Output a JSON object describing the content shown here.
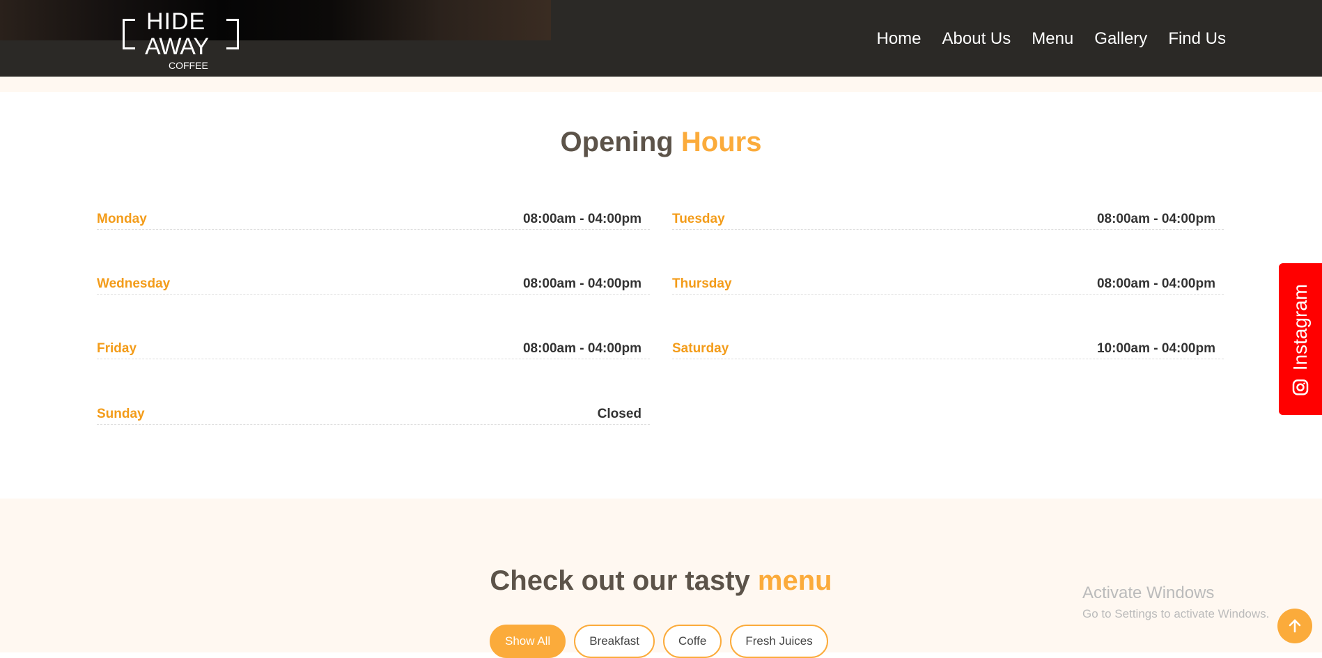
{
  "logo": {
    "line1": "HIDE",
    "line2": "AWAY",
    "line3": "COFFEE"
  },
  "nav": [
    "Home",
    "About Us",
    "Menu",
    "Gallery",
    "Find Us"
  ],
  "hours": {
    "title_a": "Opening",
    "title_b": "Hours",
    "rows": [
      {
        "day": "Monday",
        "hours": "08:00am - 04:00pm"
      },
      {
        "day": "Tuesday",
        "hours": "08:00am - 04:00pm"
      },
      {
        "day": "Wednesday",
        "hours": "08:00am - 04:00pm"
      },
      {
        "day": "Thursday",
        "hours": "08:00am - 04:00pm"
      },
      {
        "day": "Friday",
        "hours": "08:00am - 04:00pm"
      },
      {
        "day": "Saturday",
        "hours": "10:00am - 04:00pm"
      },
      {
        "day": "Sunday",
        "hours": "Closed"
      }
    ]
  },
  "menu": {
    "title_a": "Check out our tasty",
    "title_b": "menu",
    "filters": [
      "Show All",
      "Breakfast",
      "Coffe",
      "Fresh Juices"
    ]
  },
  "instagram": "Instagram",
  "windows": {
    "title": "Activate Windows",
    "sub": "Go to Settings to activate Windows."
  },
  "colors": {
    "accent": "#fbab3b",
    "day": "#f39c1a",
    "header": "#2b2926",
    "instagram": "#ff0000"
  }
}
